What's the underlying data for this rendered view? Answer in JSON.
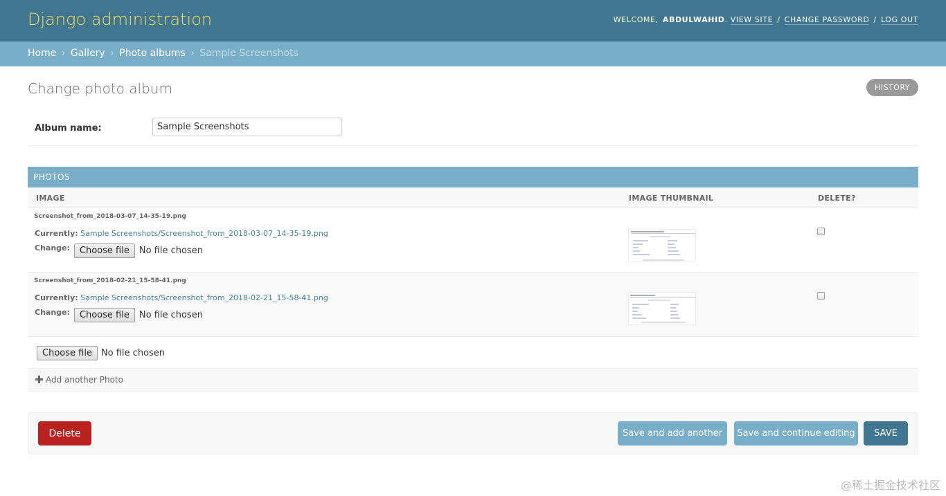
{
  "header": {
    "site_name": "Django administration",
    "welcome": "WELCOME,",
    "username": "ABDULWAHID",
    "view_site": "VIEW SITE",
    "change_password": "CHANGE PASSWORD",
    "log_out": "LOG OUT",
    "separator": "/"
  },
  "breadcrumbs": {
    "items": [
      "Home",
      "Gallery",
      "Photo albums"
    ],
    "current": "Sample Screenshots",
    "separator": "›"
  },
  "page": {
    "title": "Change photo album",
    "history": "HISTORY"
  },
  "album_form": {
    "label": "Album name:",
    "value": "Sample Screenshots"
  },
  "photos": {
    "heading": "PHOTOS",
    "columns": [
      "IMAGE",
      "IMAGE THUMBNAIL",
      "DELETE?"
    ],
    "rows": [
      {
        "original": "Screenshot_from_2018-03-07_14-35-19.png",
        "currently_label": "Currently:",
        "currently_value": "Sample Screenshots/Screenshot_from_2018-03-07_14-35-19.png",
        "change_label": "Change:",
        "choose_file": "Choose file",
        "no_file": "No file chosen"
      },
      {
        "original": "Screenshot_from_2018-02-21_15-58-41.png",
        "currently_label": "Currently:",
        "currently_value": "Sample Screenshots/Screenshot_from_2018-02-21_15-58-41.png",
        "change_label": "Change:",
        "choose_file": "Choose file",
        "no_file": "No file chosen"
      }
    ],
    "empty_form": {
      "choose_file": "Choose file",
      "no_file": "No file chosen"
    },
    "add_another": "Add another Photo"
  },
  "actions": {
    "delete": "Delete",
    "save_add_another": "Save and add another",
    "save_continue": "Save and continue editing",
    "save": "SAVE"
  },
  "watermark": "@稀土掘金技术社区",
  "colors": {
    "header_bg": "#417690",
    "breadcrumb_bg": "#79aec8",
    "branding": "#f5dd5d",
    "delete": "#ba2121",
    "save": "#417690"
  }
}
